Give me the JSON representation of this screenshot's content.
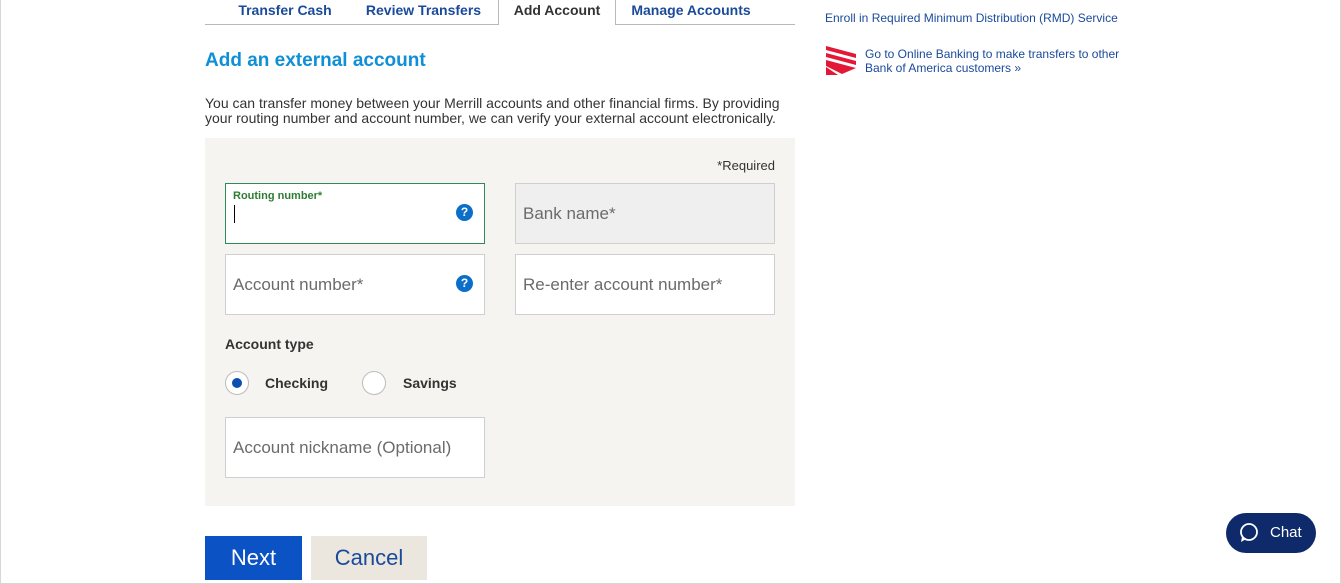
{
  "tabs": [
    {
      "label": "Transfer Cash",
      "active": false
    },
    {
      "label": "Review Transfers",
      "active": false
    },
    {
      "label": "Add Account",
      "active": true
    },
    {
      "label": "Manage Accounts",
      "active": false
    }
  ],
  "heading": "Add an external account",
  "intro": "You can transfer money between your Merrill accounts and other financial firms. By providing your routing number and account number, we can verify your external account electronically.",
  "form": {
    "required_note": "*Required",
    "routing": {
      "label": "Routing number*",
      "value": ""
    },
    "bank_name": {
      "placeholder": "Bank name*"
    },
    "account_number": {
      "placeholder": "Account number*"
    },
    "reenter_account": {
      "placeholder": "Re-enter account number*"
    },
    "account_type_label": "Account type",
    "account_types": [
      {
        "label": "Checking",
        "selected": true
      },
      {
        "label": "Savings",
        "selected": false
      }
    ],
    "nickname": {
      "placeholder": "Account nickname (Optional)"
    },
    "help_glyph": "?"
  },
  "buttons": {
    "next": "Next",
    "cancel": "Cancel"
  },
  "sidebar": {
    "rmd_link": "Enroll in Required Minimum Distribution (RMD) Service",
    "boa_link": "Go to Online Banking to make transfers to other Bank of America customers »"
  },
  "chat": {
    "label": "Chat"
  },
  "colors": {
    "accent_blue": "#0b52c4",
    "heading_blue": "#0f8fd6",
    "link_blue": "#1a4a9a",
    "focus_green": "#2e8b57",
    "chat_navy": "#0e2a6b",
    "panel_bg": "#f5f4f0"
  }
}
